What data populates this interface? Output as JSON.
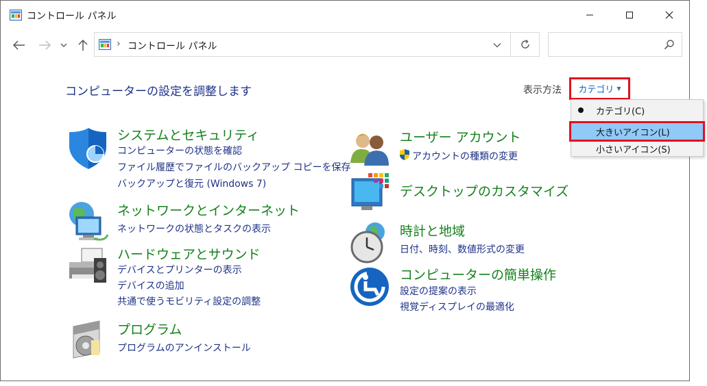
{
  "window": {
    "title": "コントロール パネル"
  },
  "address": {
    "path": "コントロール パネル",
    "separator": "›",
    "search_placeholder": ""
  },
  "main": {
    "title": "コンピューターの設定を調整します",
    "view_label": "表示方法",
    "view_value": "カテゴリ",
    "view_menu": [
      {
        "label": "カテゴリ(C)",
        "selected": true
      },
      {
        "label": "大きいアイコン(L)",
        "highlighted": true
      },
      {
        "label": "小さいアイコン(S)"
      }
    ]
  },
  "categories": {
    "system": {
      "title": "システムとセキュリティ",
      "links": [
        "コンピューターの状態を確認",
        "ファイル履歴でファイルのバックアップ コピーを保存",
        "バックアップと復元 (Windows 7)"
      ]
    },
    "network": {
      "title": "ネットワークとインターネット",
      "links": [
        "ネットワークの状態とタスクの表示"
      ]
    },
    "hardware": {
      "title": "ハードウェアとサウンド",
      "links": [
        "デバイスとプリンターの表示",
        "デバイスの追加",
        "共通で使うモビリティ設定の調整"
      ]
    },
    "programs": {
      "title": "プログラム",
      "links": [
        "プログラムのアンインストール"
      ]
    },
    "users": {
      "title": "ユーザー アカウント",
      "links": [
        "アカウントの種類の変更"
      ]
    },
    "desktop": {
      "title": "デスクトップのカスタマイズ",
      "links": []
    },
    "clock": {
      "title": "時計と地域",
      "links": [
        "日付、時刻、数値形式の変更"
      ]
    },
    "access": {
      "title": "コンピューターの簡単操作",
      "links": [
        "設定の提案の表示",
        "視覚ディスプレイの最適化"
      ]
    }
  },
  "colors": {
    "heading_green": "#14801b",
    "link_blue": "#1e3287",
    "highlight_red": "#e0121e",
    "menu_highlight": "#91c9f7"
  }
}
